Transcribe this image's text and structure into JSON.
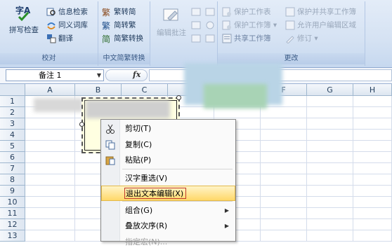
{
  "ribbon": {
    "proofing": {
      "title": "校对",
      "spelling": "拼写检查",
      "research": "信息检索",
      "thesaurus": "同义词库",
      "translate": "翻译"
    },
    "conversion": {
      "title": "中文简繁转换",
      "to_simplified": "繁转简",
      "to_traditional": "简转繁",
      "convert": "简繁转换"
    },
    "comments": {
      "edit_comment": "编辑批注"
    },
    "changes": {
      "title": "更改",
      "protect_sheet": "保护工作表",
      "protect_workbook": "保护工作簿",
      "share_workbook": "共享工作簿",
      "protect_share": "保护并共享工作簿",
      "allow_edit_ranges": "允许用户编辑区域",
      "track_changes": "修订"
    }
  },
  "formula_bar": {
    "name_box": "备注 1",
    "fx": "fx"
  },
  "grid": {
    "columns": [
      "A",
      "B",
      "C",
      "D",
      "E",
      "F",
      "G",
      "H"
    ],
    "rows": [
      "1",
      "2",
      "3",
      "4",
      "5",
      "6",
      "7",
      "8",
      "9",
      "10",
      "11",
      "12",
      "13"
    ]
  },
  "context_menu": {
    "items": [
      {
        "label": "剪切(T)",
        "icon": "scissors-icon"
      },
      {
        "label": "复制(C)",
        "icon": "copy-icon"
      },
      {
        "label": "粘贴(P)",
        "icon": "paste-icon"
      },
      {
        "label": "汉字重选(V)",
        "icon": ""
      },
      {
        "label": "退出文本编辑(X)",
        "icon": ""
      },
      {
        "label": "组合(G)",
        "icon": "",
        "submenu": true
      },
      {
        "label": "叠放次序(R)",
        "icon": "",
        "submenu": true
      },
      {
        "label": "指定宏(N)...",
        "icon": ""
      }
    ],
    "highlighted_index": 4
  }
}
